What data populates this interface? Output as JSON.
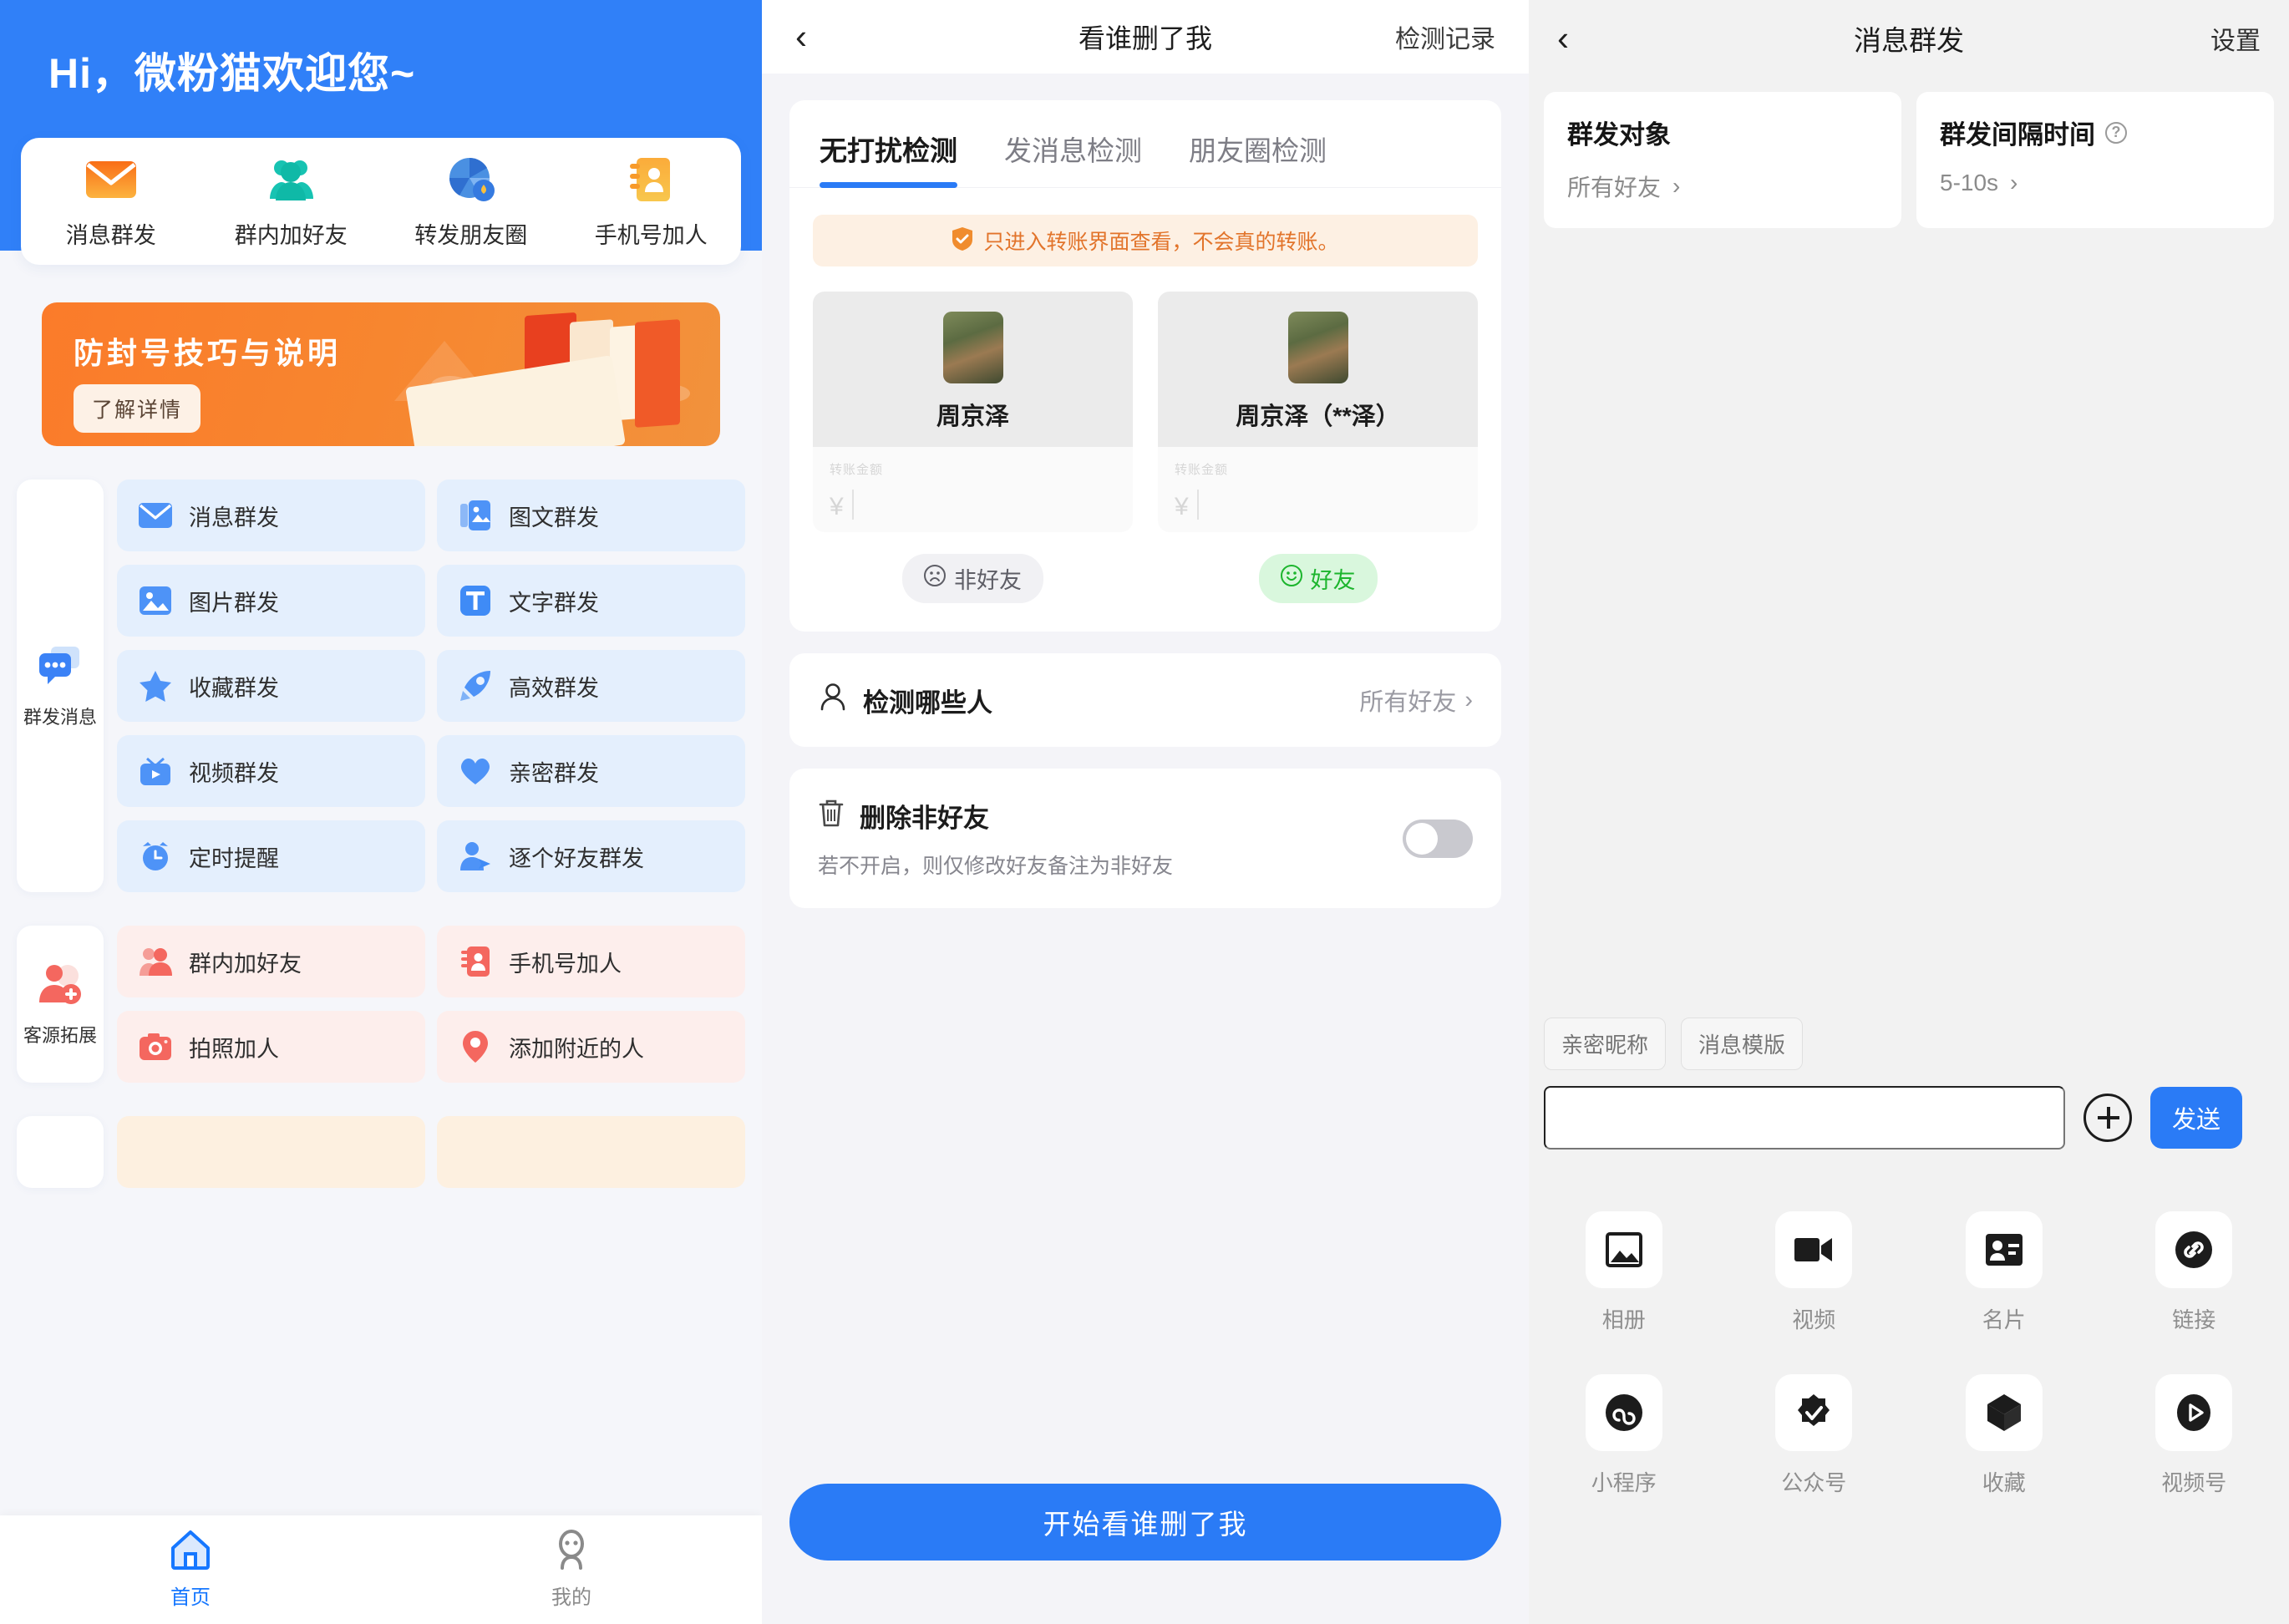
{
  "panel_home": {
    "greeting": "Hi，微粉猫欢迎您~",
    "quick_actions": [
      {
        "label": "消息群发",
        "icon": "mail-icon"
      },
      {
        "label": "群内加好友",
        "icon": "group-people-icon"
      },
      {
        "label": "转发朋友圈",
        "icon": "aperture-share-icon"
      },
      {
        "label": "手机号加人",
        "icon": "contact-book-icon"
      }
    ],
    "banner": {
      "title": "防封号技巧与说明",
      "button": "了解详情"
    },
    "sections": [
      {
        "name": "群发消息",
        "icon": "chat-bubbles-icon",
        "theme": "blue",
        "items": [
          {
            "label": "消息群发",
            "icon": "mail-icon"
          },
          {
            "label": "图文群发",
            "icon": "image-text-icon"
          },
          {
            "label": "图片群发",
            "icon": "picture-icon"
          },
          {
            "label": "文字群发",
            "icon": "text-t-icon"
          },
          {
            "label": "收藏群发",
            "icon": "star-icon"
          },
          {
            "label": "高效群发",
            "icon": "rocket-icon"
          },
          {
            "label": "视频群发",
            "icon": "tv-play-icon"
          },
          {
            "label": "亲密群发",
            "icon": "heart-icon"
          },
          {
            "label": "定时提醒",
            "icon": "alarm-clock-icon"
          },
          {
            "label": "逐个好友群发",
            "icon": "person-send-icon"
          }
        ]
      },
      {
        "name": "客源拓展",
        "icon": "person-plus-icon",
        "theme": "pink",
        "items": [
          {
            "label": "群内加好友",
            "icon": "group-people-icon"
          },
          {
            "label": "手机号加人",
            "icon": "contact-book-icon"
          },
          {
            "label": "拍照加人",
            "icon": "camera-icon"
          },
          {
            "label": "添加附近的人",
            "icon": "location-pin-icon"
          }
        ]
      },
      {
        "name": "",
        "icon": "",
        "theme": "amber",
        "items": [
          {
            "label": "",
            "icon": ""
          },
          {
            "label": "",
            "icon": ""
          }
        ]
      }
    ],
    "tabbar": [
      {
        "label": "首页",
        "icon": "home-icon",
        "active": true
      },
      {
        "label": "我的",
        "icon": "profile-icon",
        "active": false
      }
    ]
  },
  "panel_detect": {
    "header": {
      "back": "‹",
      "title": "看谁删了我",
      "action": "检测记录"
    },
    "tabs": [
      {
        "label": "无打扰检测",
        "active": true
      },
      {
        "label": "发消息检测",
        "active": false
      },
      {
        "label": "朋友圈检测",
        "active": false
      }
    ],
    "notice": {
      "icon": "shield-check-icon",
      "text": "只进入转账界面查看，不会真的转账。"
    },
    "preview_cards": [
      {
        "name": "周京泽",
        "amount_caption": "转账金额",
        "currency": "¥",
        "badge": "非好友",
        "badge_icon": "sad-face-icon",
        "badge_type": "gray"
      },
      {
        "name": "周京泽（**泽）",
        "amount_caption": "转账金额",
        "currency": "¥",
        "badge": "好友",
        "badge_icon": "smile-face-icon",
        "badge_type": "green"
      }
    ],
    "rows": [
      {
        "icon": "person-icon",
        "label": "检测哪些人",
        "value": "所有好友",
        "chevron": "›"
      }
    ],
    "toggle_row": {
      "icon": "trash-icon",
      "label": "删除非好友",
      "sublabel": "若不开启，则仅修改好友备注为非好友",
      "enabled": false
    },
    "cta": "开始看谁删了我"
  },
  "panel_mass": {
    "header": {
      "back": "‹",
      "title": "消息群发",
      "action": "设置"
    },
    "cards": [
      {
        "title": "群发对象",
        "value": "所有好友",
        "chevron": "›",
        "has_help": false
      },
      {
        "title": "群发间隔时间",
        "value": "5-10s",
        "chevron": "›",
        "has_help": true,
        "help_icon": "question-circle-icon"
      }
    ],
    "chips": [
      "亲密昵称",
      "消息模版"
    ],
    "composer": {
      "input_value": "",
      "input_placeholder": "",
      "plus_icon": "plus-circle-icon",
      "send_label": "发送"
    },
    "attachments": [
      {
        "label": "相册",
        "icon": "photo-icon"
      },
      {
        "label": "视频",
        "icon": "video-camera-icon"
      },
      {
        "label": "名片",
        "icon": "id-card-icon"
      },
      {
        "label": "链接",
        "icon": "link-icon"
      },
      {
        "label": "小程序",
        "icon": "mini-program-icon"
      },
      {
        "label": "公众号",
        "icon": "official-account-icon"
      },
      {
        "label": "收藏",
        "icon": "favorite-box-icon"
      },
      {
        "label": "视频号",
        "icon": "channels-play-icon"
      }
    ]
  },
  "colors": {
    "brand_blue": "#3080f8",
    "accent_blue": "#2a7bf6",
    "banner_orange": "#f7862f",
    "friend_green": "#1cb52d",
    "pink_tile": "#fdeeec",
    "blue_tile": "#e4effd"
  }
}
